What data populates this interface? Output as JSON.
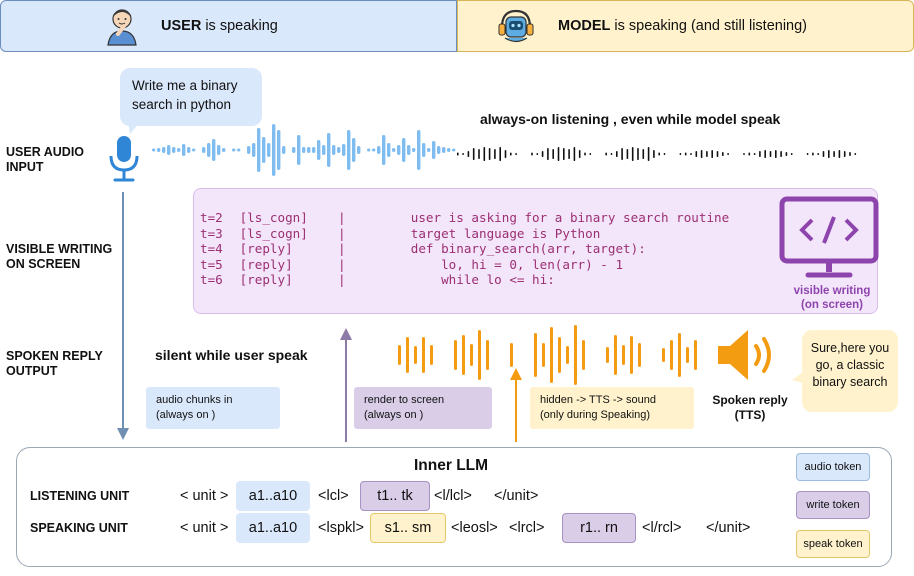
{
  "banner": {
    "user": {
      "bold": "USER",
      "rest": " is speaking"
    },
    "model": {
      "bold": "MODEL",
      "rest": " is speaking (and still listening)"
    }
  },
  "rows": {
    "audio_input": [
      "USER AUDIO",
      "INPUT"
    ],
    "visible_writing": [
      "VISIBLE WRITING",
      "ON SCREEN"
    ],
    "spoken_reply": [
      "SPOKEN REPLY",
      "OUTPUT"
    ]
  },
  "user_bubble": [
    "Write me a binary",
    "search in python"
  ],
  "always_on": "always-on listening , even while model speak",
  "silent": "silent while user speak",
  "code_lines": [
    {
      "t": "t=2",
      "tag": "[ls_cogn]",
      "sep": "|",
      "text": "   user is asking for a binary search routine"
    },
    {
      "t": "t=3",
      "tag": "[ls_cogn]",
      "sep": "|",
      "text": "   target language is Python"
    },
    {
      "t": "t=4",
      "tag": "[reply]",
      "sep": "|",
      "text": "   def binary_search(arr, target):"
    },
    {
      "t": "t=5",
      "tag": "[reply]",
      "sep": "|",
      "text": "       lo, hi = 0, len(arr) - 1"
    },
    {
      "t": "t=6",
      "tag": "[reply]",
      "sep": "|",
      "text": "       while lo <= hi:"
    }
  ],
  "monitor_label": [
    "visible writing",
    "(on screen)"
  ],
  "chips": {
    "audio_chunks": [
      "audio chunks in",
      "(always on )"
    ],
    "render": [
      "render to screen",
      "(always on )"
    ],
    "tts": [
      "hidden -> TTS -> sound",
      "(only during Speaking)"
    ]
  },
  "speaker_label": [
    "Spoken reply",
    "(TTS)"
  ],
  "model_bubble": [
    "Sure,here you",
    "go, a classic",
    "binary search"
  ],
  "inner": {
    "title": "Inner LLM",
    "listening": {
      "label": "LISTENING UNIT",
      "tokens": [
        "< unit >",
        "a1..a10",
        "<lcl>",
        "t1.. tk",
        "<l/lcl>",
        "</unit>"
      ]
    },
    "speaking": {
      "label": "SPEAKING UNIT",
      "tokens": [
        "< unit >",
        "a1..a10",
        "<lspkl>",
        "s1.. sm",
        "<leosl>",
        "<lrcl>",
        "r1.. rn",
        "<l/rcl>",
        "</unit>"
      ]
    },
    "legend": [
      "audio token",
      "write token",
      "speak token"
    ]
  },
  "colors": {
    "user_blue": "#dae8fc",
    "model_yellow": "#fff2cc",
    "audio_blue": "#7fbcf0",
    "mic_blue": "#2f86d6",
    "write_purple": "#8e44ad",
    "write_lilac": "#d9cde8",
    "speak_orange": "#f39c12",
    "speak_yellow": "#fff2cc",
    "arrow_gray_blue": "#6f8fb3"
  }
}
